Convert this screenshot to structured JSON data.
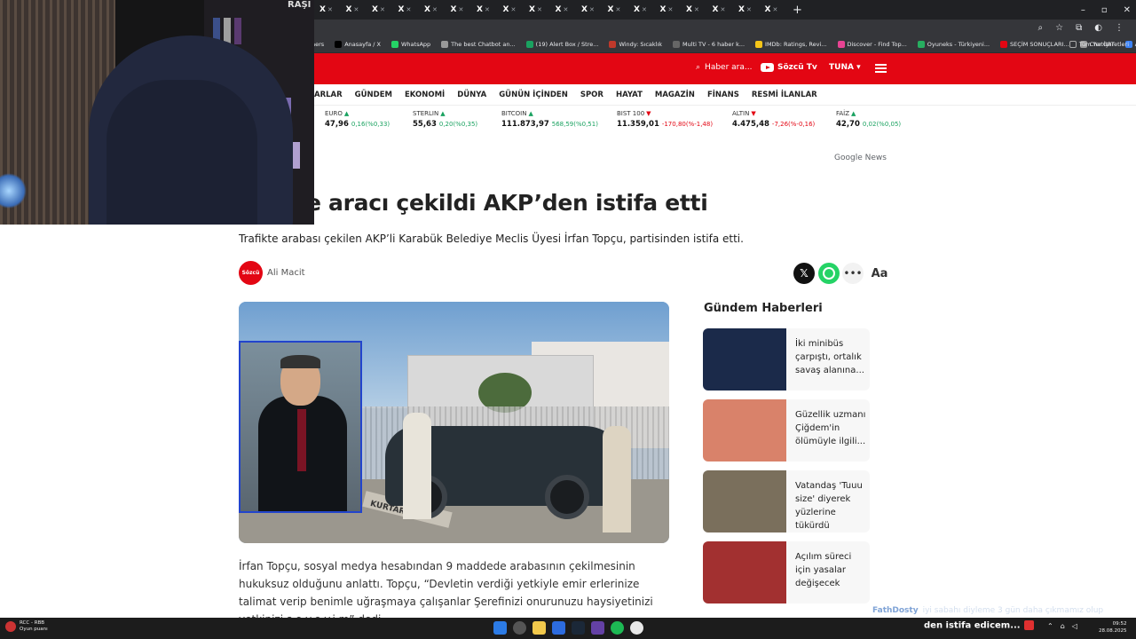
{
  "browser": {
    "tabs": [
      "X",
      "X",
      "X",
      "X",
      "X",
      "X",
      "X",
      "X",
      "X",
      "X",
      "X",
      "Sö",
      "X",
      "X",
      "X",
      "X",
      "X",
      "X",
      "X",
      "X",
      "X",
      "X",
      "X",
      "X",
      "X",
      "X",
      "X",
      "X",
      "X",
      "X"
    ],
    "bookmarks": [
      {
        "label": "ners",
        "color": "#555"
      },
      {
        "label": "Anasayfa / X",
        "color": "#000"
      },
      {
        "label": "WhatsApp",
        "color": "#25d366"
      },
      {
        "label": "The best Chatbot an...",
        "color": "#999"
      },
      {
        "label": "(19) Alert Box / Stre...",
        "color": "#1aa260"
      },
      {
        "label": "Windy: Sıcaklık",
        "color": "#c0392b"
      },
      {
        "label": "Multi TV - 6 haber k...",
        "color": "#666"
      },
      {
        "label": "IMDb: Ratings, Revi...",
        "color": "#f5c518"
      },
      {
        "label": "Discover - Find Top...",
        "color": "#e84393"
      },
      {
        "label": "Oyuneks - Türkiyeni...",
        "color": "#27ae60"
      },
      {
        "label": "SEÇİM SONUÇLARI...",
        "color": "#e30613"
      },
      {
        "label": "ChatGPT",
        "color": "#999"
      },
      {
        "label": "APiq",
        "color": "#3b82f6"
      }
    ],
    "bookmarks_right": "Tüm Yer İşaretleri"
  },
  "site": {
    "search_placeholder": "Haber ara...",
    "sozcu_tv": "Sözcü Tv",
    "user": "TUNA",
    "nav": [
      "ARLAR",
      "GÜNDEM",
      "EKONOMİ",
      "DÜNYA",
      "GÜNÜN İÇİNDEN",
      "SPOR",
      "HAYAT",
      "MAGAZİN",
      "FİNANS",
      "RESMİ İLANLAR"
    ],
    "google_news": "Google News"
  },
  "ticker": [
    {
      "name": "EURO",
      "dir": "up",
      "value": "47,96",
      "change": "0,16(%0,33)"
    },
    {
      "name": "STERLIN",
      "dir": "up",
      "value": "55,63",
      "change": "0,20(%0,35)"
    },
    {
      "name": "BITCOIN",
      "dir": "up",
      "value": "111.873,97",
      "change": "568,59(%0,51)"
    },
    {
      "name": "BIST 100",
      "dir": "down",
      "value": "11.359,01",
      "change": "-170,80(%-1,48)"
    },
    {
      "name": "ALTIN",
      "dir": "down",
      "value": "4.475,48",
      "change": "-7,26(%-0,16)"
    },
    {
      "name": "FAİZ",
      "dir": "up",
      "value": "42,70",
      "change": "0,02(%0,05)"
    }
  ],
  "article": {
    "headline": "e aracı çekildi AKP’den istifa etti",
    "summary": "Trafikte arabası çekilen AKP’li Karabük Belediye Meclis Üyesi İrfan Topçu, partisinden istifa etti.",
    "author_logo": "Sözcü",
    "author": "Ali Macit",
    "photo_sign": "KURTARMA",
    "paragraph": "İrfan Topçu, sosyal medya hesabından 9 maddede arabasının çekilmesinin hukuksuz olduğunu anlattı. Topçu, “Devletin verdiği yetkiyle emir erlerinize talimat verip benimle uğraşmaya çalışanlar Şerefinizi onurunuzu haysiyetinizi yetkinizi s.e.v.e.y.i.m” dedi."
  },
  "sidebar": {
    "title": "Gündem Haberleri",
    "items": [
      {
        "title": "İki minibüs çarpıştı, ortalık savaş alanına...",
        "thumb_color": "#1b2a4a"
      },
      {
        "title": "Güzellik uzmanı Çiğdem'in ölümüyle ilgili...",
        "thumb_color": "#d9826a"
      },
      {
        "title": "Vatandaş 'Tuuu size' diyerek yüzlerine tükürdü",
        "thumb_color": "#7a6f5c"
      },
      {
        "title": "Açılım süreci için yasalar değişecek",
        "thumb_color": "#a23030"
      }
    ]
  },
  "webcam": {
    "brand": "RAŞİ"
  },
  "watermark": {
    "name": "FathDosty",
    "ticker": "iyi sabahı diyleme 3 gün daha çıkmamız olup"
  },
  "taskbar": {
    "left_title": "RCC - RBB",
    "left_sub": "Oyun puanı",
    "subtitle": "den istifa edicem...",
    "clock_time": "09:52",
    "clock_date": "28.08.2025"
  }
}
